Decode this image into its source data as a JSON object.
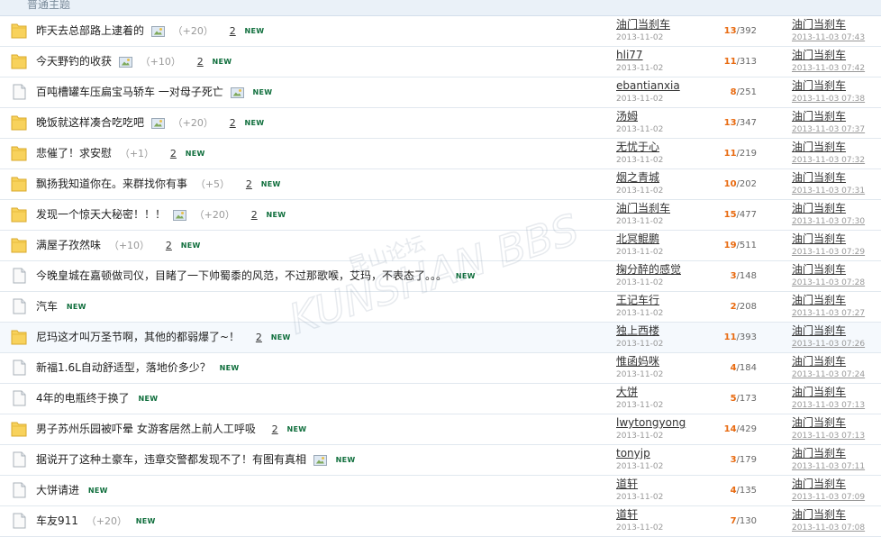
{
  "section": {
    "title": "普通主题"
  },
  "threads": [
    {
      "icon": "folder",
      "title": "昨天去总部路上逮着的",
      "image": true,
      "rating": "（+20）",
      "pages": "2",
      "new": "NEW",
      "author": "油门当刹车",
      "date": "2013-11-02",
      "replies": "13",
      "views": "392",
      "last_author": "油门当刹车",
      "last_time": "2013-11-03 07:43"
    },
    {
      "icon": "folder",
      "title": "今天野钓的收获",
      "image": true,
      "rating": "（+10）",
      "pages": "2",
      "new": "NEW",
      "author": "hli77",
      "date": "2013-11-02",
      "replies": "11",
      "views": "313",
      "last_author": "油门当刹车",
      "last_time": "2013-11-03 07:42"
    },
    {
      "icon": "doc",
      "title": "百吨槽罐车压扁宝马轿车 一对母子死亡",
      "image": true,
      "rating": "",
      "pages": "",
      "new": "NEW",
      "author": "ebantianxia",
      "date": "2013-11-02",
      "replies": "8",
      "views": "251",
      "last_author": "油门当刹车",
      "last_time": "2013-11-03 07:38"
    },
    {
      "icon": "folder",
      "title": "晚饭就这样凑合吃吃吧",
      "image": true,
      "rating": "（+20）",
      "pages": "2",
      "new": "NEW",
      "author": "汤姆",
      "date": "2013-11-02",
      "replies": "13",
      "views": "347",
      "last_author": "油门当刹车",
      "last_time": "2013-11-03 07:37"
    },
    {
      "icon": "folder",
      "title": "悲催了！求安慰",
      "image": false,
      "rating": "（+1）",
      "pages": "2",
      "new": "NEW",
      "author": "无忧于心",
      "date": "2013-11-02",
      "replies": "11",
      "views": "219",
      "last_author": "油门当刹车",
      "last_time": "2013-11-03 07:32"
    },
    {
      "icon": "folder",
      "title": "飘扬我知道你在。来群找你有事",
      "image": false,
      "rating": "（+5）",
      "pages": "2",
      "new": "NEW",
      "author": "烟之青城",
      "date": "2013-11-02",
      "replies": "10",
      "views": "202",
      "last_author": "油门当刹车",
      "last_time": "2013-11-03 07:31"
    },
    {
      "icon": "folder",
      "title": "发现一个惊天大秘密！！！",
      "image": true,
      "rating": "（+20）",
      "pages": "2",
      "new": "NEW",
      "author": "油门当刹车",
      "date": "2013-11-02",
      "replies": "15",
      "views": "477",
      "last_author": "油门当刹车",
      "last_time": "2013-11-03 07:30"
    },
    {
      "icon": "folder",
      "title": "满屋子孜然味",
      "image": false,
      "rating": "（+10）",
      "pages": "2",
      "new": "NEW",
      "author": "北冥鲲鹏",
      "date": "2013-11-02",
      "replies": "19",
      "views": "511",
      "last_author": "油门当刹车",
      "last_time": "2013-11-03 07:29"
    },
    {
      "icon": "doc",
      "title": "今晚皇城在嘉顿做司仪，目睹了一下帅蜀黍的风范，不过那歌喉，艾玛，不表态了。。。",
      "image": false,
      "rating": "",
      "pages": "",
      "new": "NEW",
      "author": "掬分醉的感觉",
      "date": "2013-11-02",
      "replies": "3",
      "views": "148",
      "last_author": "油门当刹车",
      "last_time": "2013-11-03 07:28"
    },
    {
      "icon": "doc",
      "title": "汽车",
      "image": false,
      "rating": "",
      "pages": "",
      "new": "NEW",
      "author": "王记车行",
      "date": "2013-11-02",
      "replies": "2",
      "views": "208",
      "last_author": "油门当刹车",
      "last_time": "2013-11-03 07:27"
    },
    {
      "icon": "folder",
      "title": "尼玛这才叫万圣节啊，其他的都弱爆了~！",
      "image": false,
      "rating": "",
      "pages": "2",
      "new": "NEW",
      "author": "独上西楼",
      "date": "2013-11-02",
      "replies": "11",
      "views": "393",
      "last_author": "油门当刹车",
      "last_time": "2013-11-03 07:26"
    },
    {
      "icon": "doc",
      "title": "新福1.6L自动舒适型，落地价多少？",
      "image": false,
      "rating": "",
      "pages": "",
      "new": "NEW",
      "author": "惟函妈咪",
      "date": "2013-11-02",
      "replies": "4",
      "views": "184",
      "last_author": "油门当刹车",
      "last_time": "2013-11-03 07:24"
    },
    {
      "icon": "doc",
      "title": "4年的电瓶终于换了",
      "image": false,
      "rating": "",
      "pages": "",
      "new": "NEW",
      "author": "大饼",
      "date": "2013-11-02",
      "replies": "5",
      "views": "173",
      "last_author": "油门当刹车",
      "last_time": "2013-11-03 07:13"
    },
    {
      "icon": "folder",
      "title": "男子苏州乐园被吓晕 女游客居然上前人工呼吸",
      "image": false,
      "rating": "",
      "pages": "2",
      "new": "NEW",
      "author": "lwytongyong",
      "date": "2013-11-02",
      "replies": "14",
      "views": "429",
      "last_author": "油门当刹车",
      "last_time": "2013-11-03 07:13"
    },
    {
      "icon": "doc",
      "title": "据说开了这种土豪车，违章交警都发现不了！有图有真相",
      "image": true,
      "rating": "",
      "pages": "",
      "new": "NEW",
      "author": "tonyjp",
      "date": "2013-11-02",
      "replies": "3",
      "views": "179",
      "last_author": "油门当刹车",
      "last_time": "2013-11-03 07:11"
    },
    {
      "icon": "doc",
      "title": "大饼请进",
      "image": false,
      "rating": "",
      "pages": "",
      "new": "NEW",
      "author": "道轩",
      "date": "2013-11-02",
      "replies": "4",
      "views": "135",
      "last_author": "油门当刹车",
      "last_time": "2013-11-03 07:09"
    },
    {
      "icon": "doc",
      "title": "车友911",
      "image": false,
      "rating": "（+20）",
      "pages": "",
      "new": "NEW",
      "author": "道轩",
      "date": "2013-11-02",
      "replies": "7",
      "views": "130",
      "last_author": "油门当刹车",
      "last_time": "2013-11-03 07:08"
    }
  ],
  "watermark": {
    "text": "KUNSHAN BBS",
    "chinese": "昆山论坛"
  },
  "colors": {
    "reply": "#e86a10",
    "new": "#0f6e3c",
    "header_bg": "#eaf1f8",
    "folder": "#f8d25c"
  },
  "icons": {
    "folder": "folder-icon",
    "doc": "document-icon",
    "image": "image-attachment-icon"
  }
}
